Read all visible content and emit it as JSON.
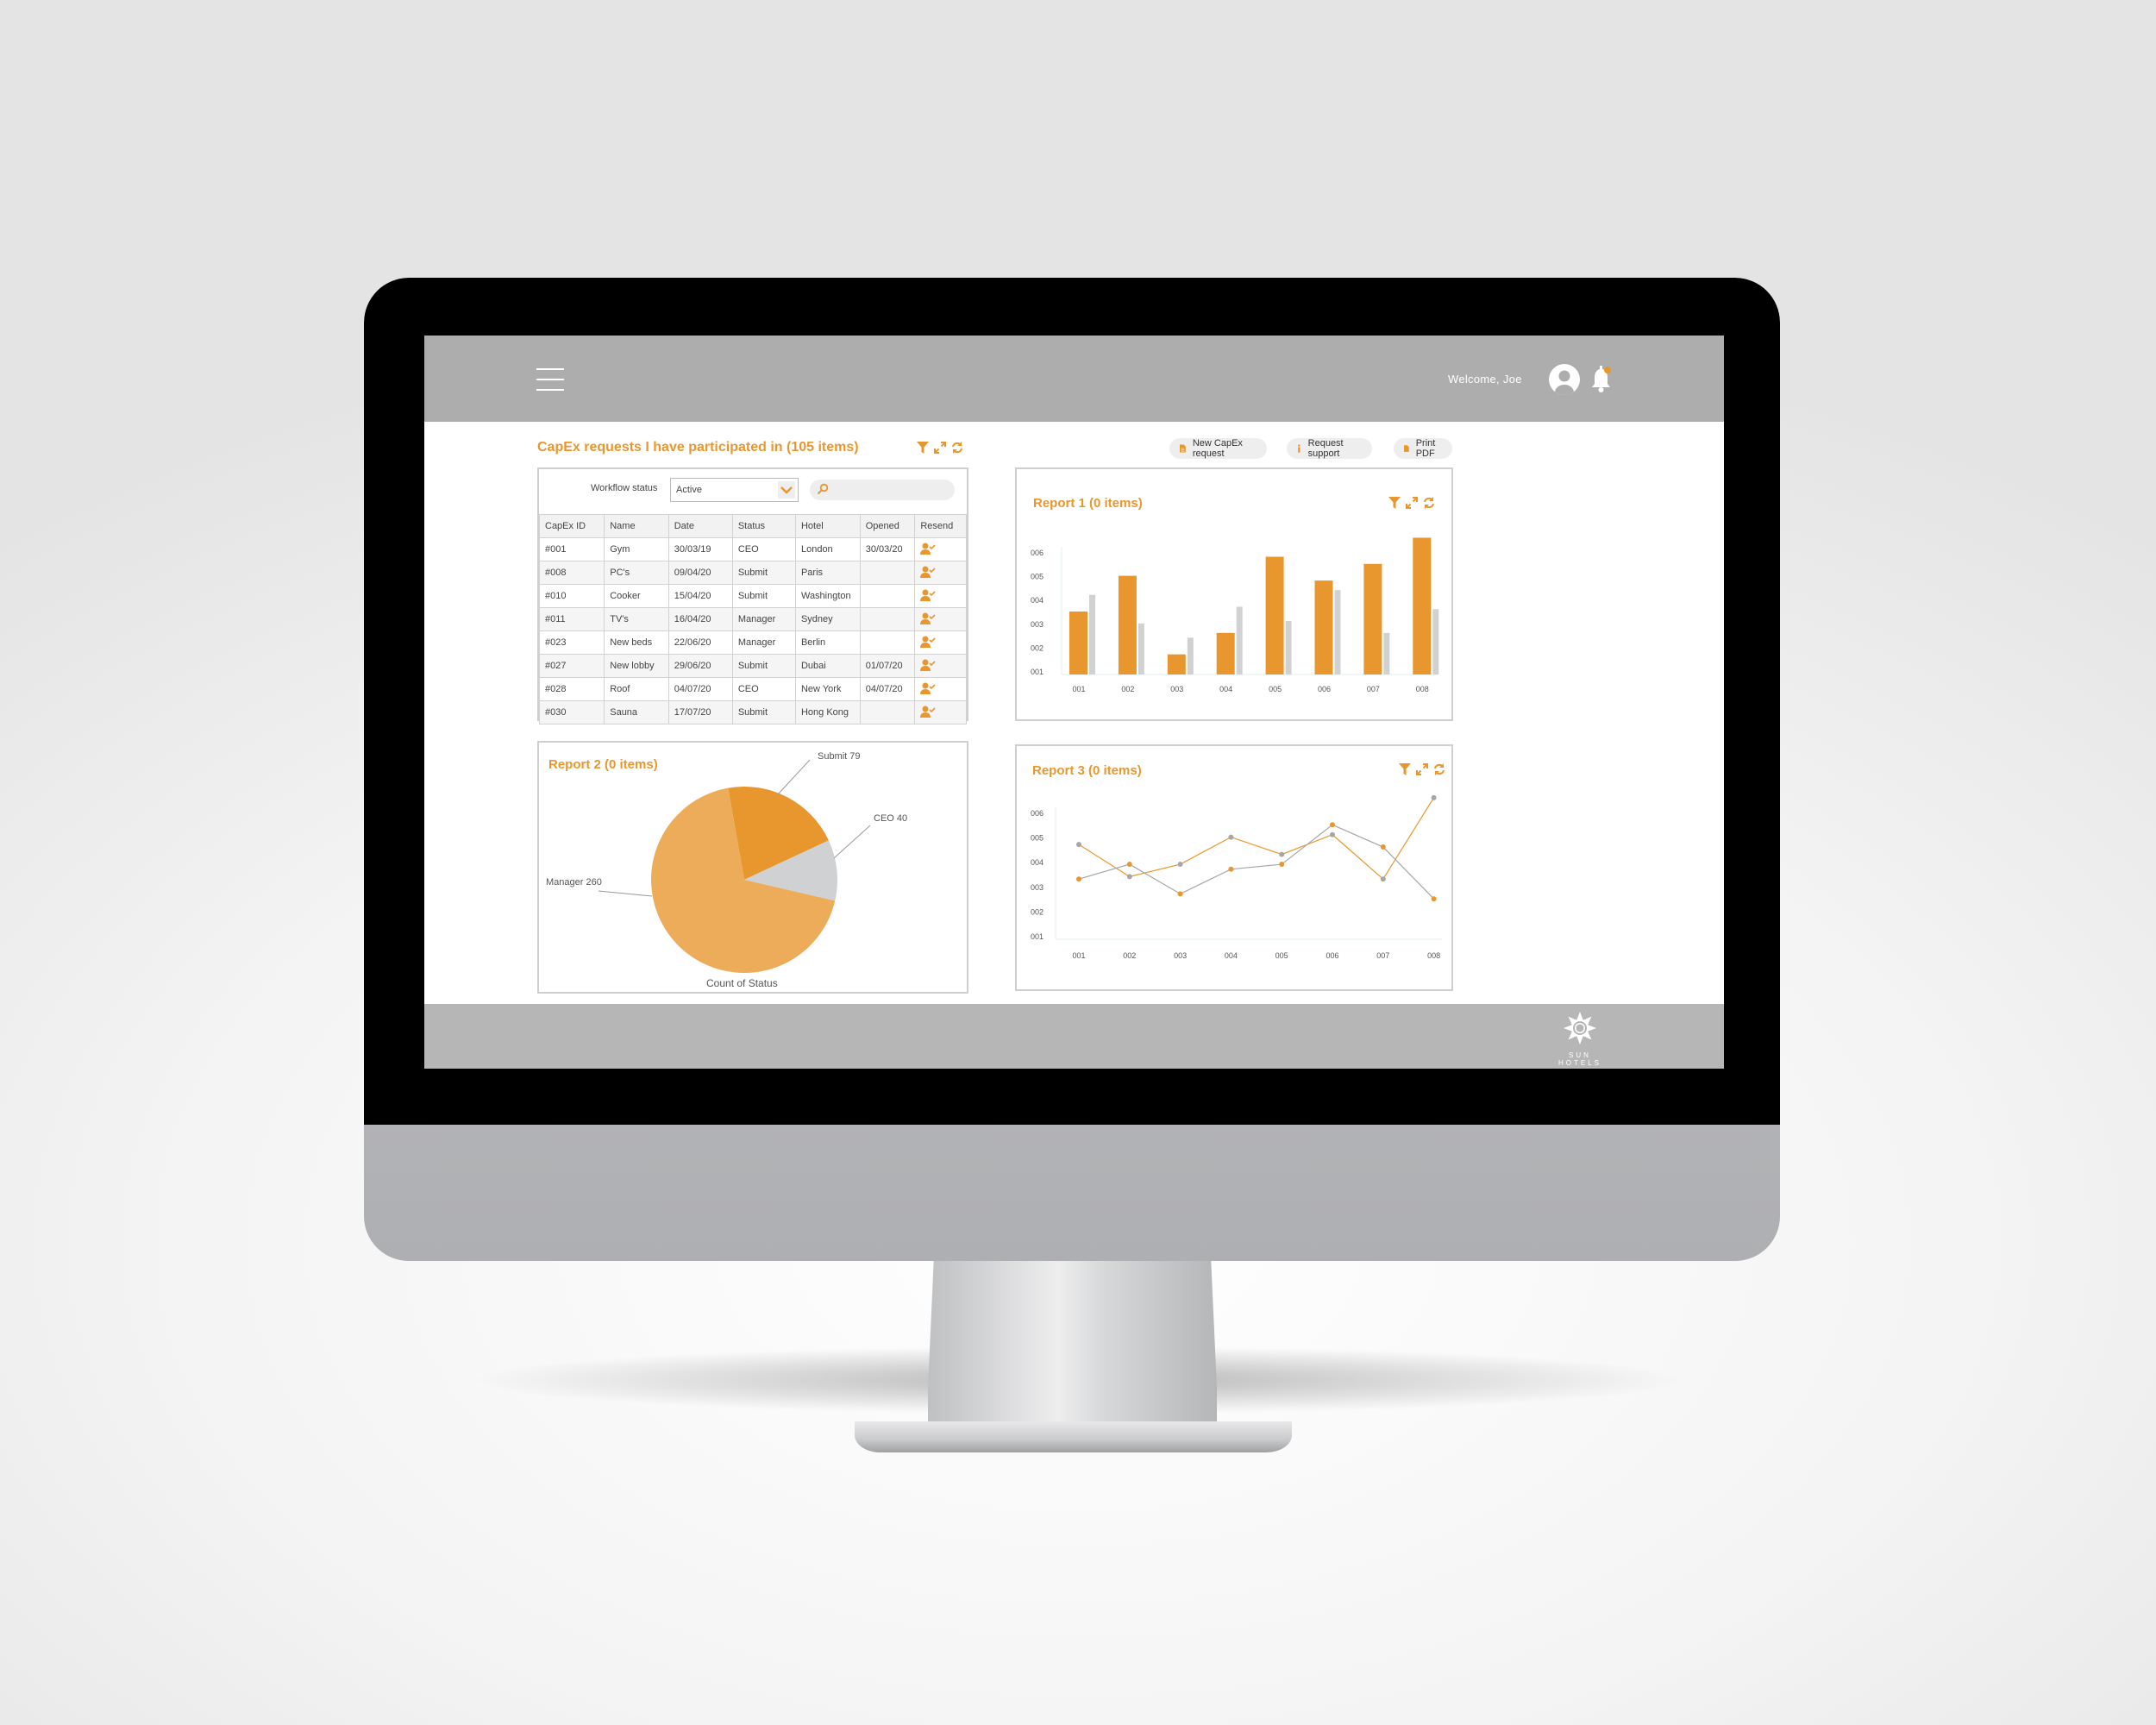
{
  "header": {
    "menu_icon": "hamburger-icon",
    "welcome": "Welcome, Joe",
    "avatar_icon": "user-avatar-icon",
    "bell_icon": "bell-icon",
    "notification_color": "#E8972F"
  },
  "table_panel": {
    "title": "CapEx requests I have participated in (105 items)",
    "filter_label": "Workflow status",
    "select_value": "Active",
    "search_value": "",
    "columns": [
      "CapEx ID",
      "Name",
      "Date",
      "Status",
      "Hotel",
      "Opened",
      "Resend"
    ],
    "rows": [
      [
        "#001",
        "Gym",
        "30/03/19",
        "CEO",
        "London",
        "30/03/20"
      ],
      [
        "#008",
        "PC's",
        "09/04/20",
        "Submit",
        "Paris",
        ""
      ],
      [
        "#010",
        "Cooker",
        "15/04/20",
        "Submit",
        "Washington",
        ""
      ],
      [
        "#011",
        "TV's",
        "16/04/20",
        "Manager",
        "Sydney",
        ""
      ],
      [
        "#023",
        "New beds",
        "22/06/20",
        "Manager",
        "Berlin",
        ""
      ],
      [
        "#027",
        "New lobby",
        "29/06/20",
        "Submit",
        "Dubai",
        "01/07/20"
      ],
      [
        "#028",
        "Roof",
        "04/07/20",
        "CEO",
        "New York",
        "04/07/20"
      ],
      [
        "#030",
        "Sauna",
        "17/07/20",
        "Submit",
        "Hong Kong",
        ""
      ]
    ]
  },
  "actions": {
    "new_capex": "New CapEx request",
    "support": "Request support",
    "print": "Print PDF"
  },
  "colors": {
    "accent": "#E8972F",
    "accent_light": "#ECAC5A",
    "gray": "#D0D1D3",
    "line_gray": "#A6A6A6",
    "topbar": "#ADADAD",
    "footer": "#B5B6B5"
  },
  "chart_data": [
    {
      "type": "bar",
      "title": "Report 1 (0 items)",
      "categories": [
        "001",
        "002",
        "003",
        "004",
        "005",
        "006",
        "007",
        "008"
      ],
      "yticks": [
        "001",
        "002",
        "003",
        "004",
        "005",
        "006"
      ],
      "ylim": [
        1,
        6
      ],
      "series": [
        {
          "color": "#E8972F",
          "values": [
            3.5,
            5.0,
            1.7,
            2.6,
            5.8,
            4.8,
            5.5,
            6.6
          ]
        },
        {
          "color": "#D0D1D3",
          "values": [
            4.2,
            3.0,
            2.4,
            3.7,
            3.1,
            4.4,
            2.6,
            3.6
          ]
        }
      ]
    },
    {
      "type": "pie",
      "title": "Report 2 (0 items)",
      "label": "Count of Status",
      "slices": [
        {
          "name": "Submit",
          "value": 79,
          "color": "#E8972F"
        },
        {
          "name": "CEO",
          "value": 40,
          "color": "#D0D1D3"
        },
        {
          "name": "Manager",
          "value": 260,
          "color": "#ECAC5A"
        }
      ]
    },
    {
      "type": "line",
      "title": "Report 3 (0 items)",
      "categories": [
        "001",
        "002",
        "003",
        "004",
        "005",
        "006",
        "007",
        "008"
      ],
      "yticks": [
        "001",
        "002",
        "003",
        "004",
        "005",
        "006"
      ],
      "ylim": [
        1,
        6
      ],
      "series": [
        {
          "line_color": "#E8972F",
          "marker_color": "#A6A6A6",
          "values": [
            4.7,
            3.4,
            3.9,
            5.0,
            4.3,
            5.1,
            3.3,
            6.6
          ]
        },
        {
          "line_color": "#A6A6A6",
          "marker_color": "#E8972F",
          "values": [
            3.3,
            3.9,
            2.7,
            3.7,
            3.9,
            5.5,
            4.6,
            2.5
          ]
        }
      ]
    }
  ],
  "footer": {
    "logo_text": "SUN HOTELS"
  }
}
